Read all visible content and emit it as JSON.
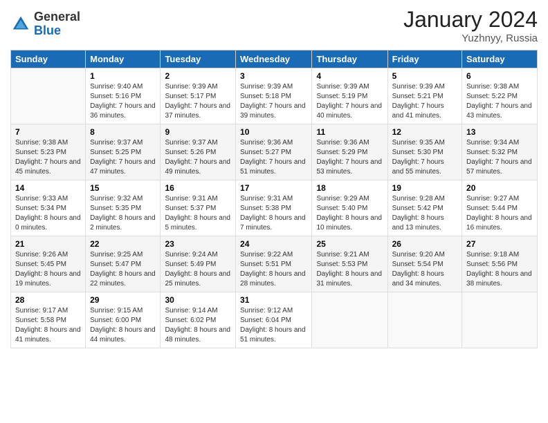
{
  "logo": {
    "general": "General",
    "blue": "Blue"
  },
  "title": "January 2024",
  "location": "Yuzhnyy, Russia",
  "days_header": [
    "Sunday",
    "Monday",
    "Tuesday",
    "Wednesday",
    "Thursday",
    "Friday",
    "Saturday"
  ],
  "weeks": [
    [
      {
        "day": "",
        "sunrise": "",
        "sunset": "",
        "daylight": ""
      },
      {
        "day": "1",
        "sunrise": "Sunrise: 9:40 AM",
        "sunset": "Sunset: 5:16 PM",
        "daylight": "Daylight: 7 hours and 36 minutes."
      },
      {
        "day": "2",
        "sunrise": "Sunrise: 9:39 AM",
        "sunset": "Sunset: 5:17 PM",
        "daylight": "Daylight: 7 hours and 37 minutes."
      },
      {
        "day": "3",
        "sunrise": "Sunrise: 9:39 AM",
        "sunset": "Sunset: 5:18 PM",
        "daylight": "Daylight: 7 hours and 39 minutes."
      },
      {
        "day": "4",
        "sunrise": "Sunrise: 9:39 AM",
        "sunset": "Sunset: 5:19 PM",
        "daylight": "Daylight: 7 hours and 40 minutes."
      },
      {
        "day": "5",
        "sunrise": "Sunrise: 9:39 AM",
        "sunset": "Sunset: 5:21 PM",
        "daylight": "Daylight: 7 hours and 41 minutes."
      },
      {
        "day": "6",
        "sunrise": "Sunrise: 9:38 AM",
        "sunset": "Sunset: 5:22 PM",
        "daylight": "Daylight: 7 hours and 43 minutes."
      }
    ],
    [
      {
        "day": "7",
        "sunrise": "Sunrise: 9:38 AM",
        "sunset": "Sunset: 5:23 PM",
        "daylight": "Daylight: 7 hours and 45 minutes."
      },
      {
        "day": "8",
        "sunrise": "Sunrise: 9:37 AM",
        "sunset": "Sunset: 5:25 PM",
        "daylight": "Daylight: 7 hours and 47 minutes."
      },
      {
        "day": "9",
        "sunrise": "Sunrise: 9:37 AM",
        "sunset": "Sunset: 5:26 PM",
        "daylight": "Daylight: 7 hours and 49 minutes."
      },
      {
        "day": "10",
        "sunrise": "Sunrise: 9:36 AM",
        "sunset": "Sunset: 5:27 PM",
        "daylight": "Daylight: 7 hours and 51 minutes."
      },
      {
        "day": "11",
        "sunrise": "Sunrise: 9:36 AM",
        "sunset": "Sunset: 5:29 PM",
        "daylight": "Daylight: 7 hours and 53 minutes."
      },
      {
        "day": "12",
        "sunrise": "Sunrise: 9:35 AM",
        "sunset": "Sunset: 5:30 PM",
        "daylight": "Daylight: 7 hours and 55 minutes."
      },
      {
        "day": "13",
        "sunrise": "Sunrise: 9:34 AM",
        "sunset": "Sunset: 5:32 PM",
        "daylight": "Daylight: 7 hours and 57 minutes."
      }
    ],
    [
      {
        "day": "14",
        "sunrise": "Sunrise: 9:33 AM",
        "sunset": "Sunset: 5:34 PM",
        "daylight": "Daylight: 8 hours and 0 minutes."
      },
      {
        "day": "15",
        "sunrise": "Sunrise: 9:32 AM",
        "sunset": "Sunset: 5:35 PM",
        "daylight": "Daylight: 8 hours and 2 minutes."
      },
      {
        "day": "16",
        "sunrise": "Sunrise: 9:31 AM",
        "sunset": "Sunset: 5:37 PM",
        "daylight": "Daylight: 8 hours and 5 minutes."
      },
      {
        "day": "17",
        "sunrise": "Sunrise: 9:31 AM",
        "sunset": "Sunset: 5:38 PM",
        "daylight": "Daylight: 8 hours and 7 minutes."
      },
      {
        "day": "18",
        "sunrise": "Sunrise: 9:29 AM",
        "sunset": "Sunset: 5:40 PM",
        "daylight": "Daylight: 8 hours and 10 minutes."
      },
      {
        "day": "19",
        "sunrise": "Sunrise: 9:28 AM",
        "sunset": "Sunset: 5:42 PM",
        "daylight": "Daylight: 8 hours and 13 minutes."
      },
      {
        "day": "20",
        "sunrise": "Sunrise: 9:27 AM",
        "sunset": "Sunset: 5:44 PM",
        "daylight": "Daylight: 8 hours and 16 minutes."
      }
    ],
    [
      {
        "day": "21",
        "sunrise": "Sunrise: 9:26 AM",
        "sunset": "Sunset: 5:45 PM",
        "daylight": "Daylight: 8 hours and 19 minutes."
      },
      {
        "day": "22",
        "sunrise": "Sunrise: 9:25 AM",
        "sunset": "Sunset: 5:47 PM",
        "daylight": "Daylight: 8 hours and 22 minutes."
      },
      {
        "day": "23",
        "sunrise": "Sunrise: 9:24 AM",
        "sunset": "Sunset: 5:49 PM",
        "daylight": "Daylight: 8 hours and 25 minutes."
      },
      {
        "day": "24",
        "sunrise": "Sunrise: 9:22 AM",
        "sunset": "Sunset: 5:51 PM",
        "daylight": "Daylight: 8 hours and 28 minutes."
      },
      {
        "day": "25",
        "sunrise": "Sunrise: 9:21 AM",
        "sunset": "Sunset: 5:53 PM",
        "daylight": "Daylight: 8 hours and 31 minutes."
      },
      {
        "day": "26",
        "sunrise": "Sunrise: 9:20 AM",
        "sunset": "Sunset: 5:54 PM",
        "daylight": "Daylight: 8 hours and 34 minutes."
      },
      {
        "day": "27",
        "sunrise": "Sunrise: 9:18 AM",
        "sunset": "Sunset: 5:56 PM",
        "daylight": "Daylight: 8 hours and 38 minutes."
      }
    ],
    [
      {
        "day": "28",
        "sunrise": "Sunrise: 9:17 AM",
        "sunset": "Sunset: 5:58 PM",
        "daylight": "Daylight: 8 hours and 41 minutes."
      },
      {
        "day": "29",
        "sunrise": "Sunrise: 9:15 AM",
        "sunset": "Sunset: 6:00 PM",
        "daylight": "Daylight: 8 hours and 44 minutes."
      },
      {
        "day": "30",
        "sunrise": "Sunrise: 9:14 AM",
        "sunset": "Sunset: 6:02 PM",
        "daylight": "Daylight: 8 hours and 48 minutes."
      },
      {
        "day": "31",
        "sunrise": "Sunrise: 9:12 AM",
        "sunset": "Sunset: 6:04 PM",
        "daylight": "Daylight: 8 hours and 51 minutes."
      },
      {
        "day": "",
        "sunrise": "",
        "sunset": "",
        "daylight": ""
      },
      {
        "day": "",
        "sunrise": "",
        "sunset": "",
        "daylight": ""
      },
      {
        "day": "",
        "sunrise": "",
        "sunset": "",
        "daylight": ""
      }
    ]
  ]
}
